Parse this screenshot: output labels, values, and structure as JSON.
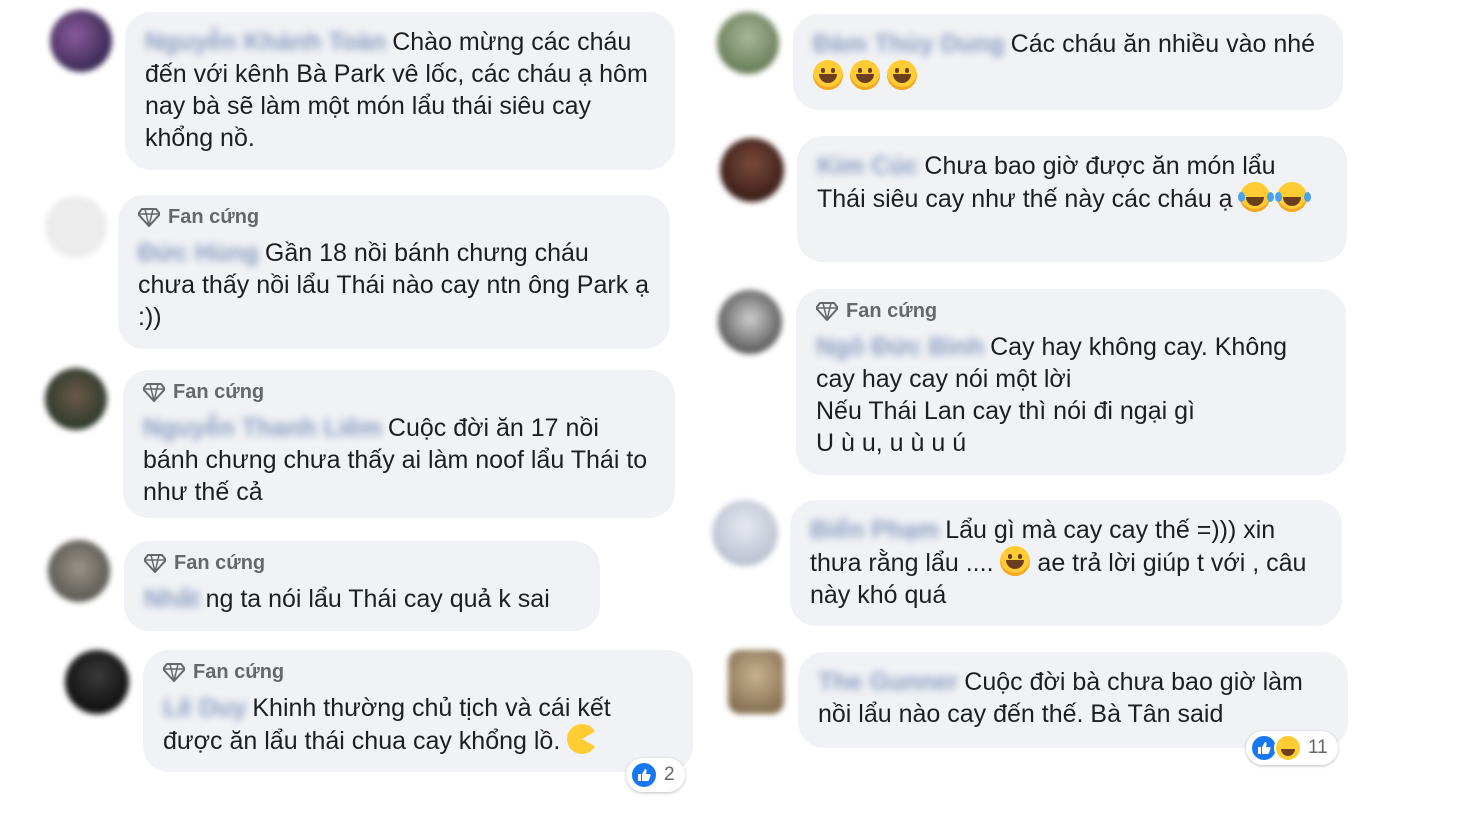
{
  "badge_label": "Fan cứng",
  "comments_left": [
    {
      "name": "Nguyễn Khánh Toàn",
      "text": "Chào mừng các cháu đến với kênh Bà Park vê lốc, các cháu ạ hôm nay bà sẽ làm một món lẩu thái siêu cay khổng nồ."
    },
    {
      "name": "Đức Hùng",
      "text": "Gần 18 nồi bánh chưng cháu chưa thấy nồi lẩu Thái nào cay ntn ông Park ạ :))"
    },
    {
      "name": "Nguyễn Thanh Liêm",
      "text": "Cuộc đời ăn 17 nồi bánh chưng chưa thấy ai làm noof lẩu Thái to như thế cả"
    },
    {
      "name": "Nhất",
      "text": "ng ta nói lẩu Thái cay quả k sai"
    },
    {
      "name": "Lê Duy",
      "text": "Khinh thường chủ tịch và cái kết được ăn lẩu thái chua cay khổng lồ.",
      "reaction_count": "2"
    }
  ],
  "comments_right": [
    {
      "name": "Đàm Thùy Dung",
      "text": "Các cháu ăn nhiều vào nhé"
    },
    {
      "name": "Kim Cúc",
      "text": "Chưa bao giờ được ăn món lẩu Thái siêu cay như thế này các cháu ạ"
    },
    {
      "name": "Ngô Đức Bình",
      "text_lines": [
        "Cay hay không cay. Không",
        "cay hay cay nói một lời",
        "Nếu Thái Lan cay thì nói đi ngại gì",
        "U ù u, u ù u ú"
      ]
    },
    {
      "name": "Biển Phạm",
      "text_a": "Lẩu gì mà cay cay thế =))) xin thưa rằng lẩu ....",
      "text_b": "ae trả lời giúp t với , câu này khó quá"
    },
    {
      "name": "The Gunner",
      "text": "Cuộc đời bà chưa bao giờ làm nồi lẩu nào cay đến thế. Bà Tân said",
      "reaction_count": "11"
    }
  ],
  "colors": {
    "bubble": "#f0f2f5",
    "like": "#1877f2",
    "name_link": "#385898"
  }
}
